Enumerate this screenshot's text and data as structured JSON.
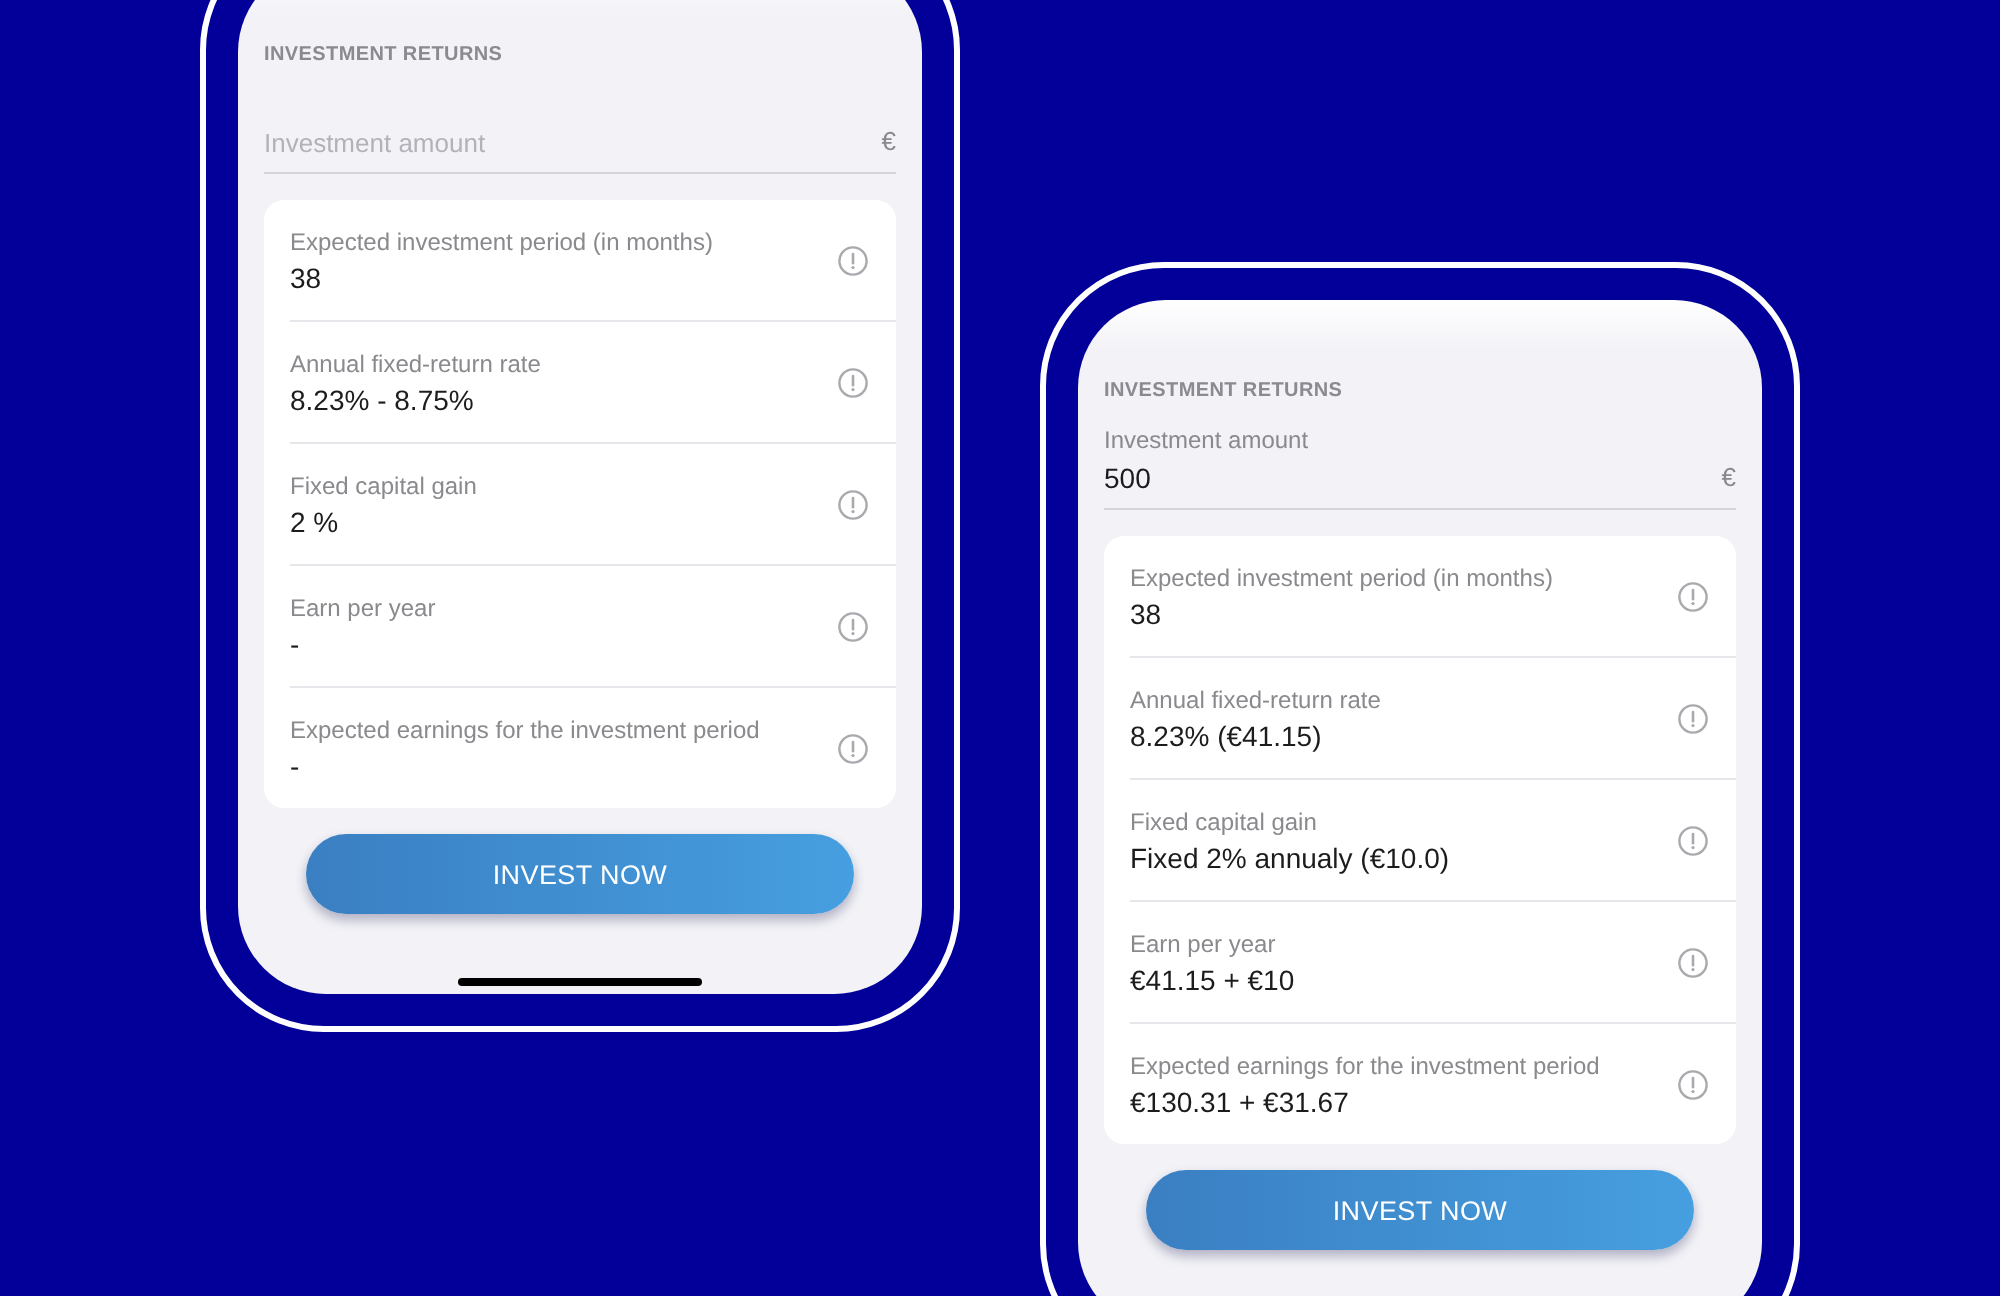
{
  "phones": [
    {
      "section_title": "INVESTMENT RETURNS",
      "amount_field": {
        "placeholder": "Investment amount",
        "currency": "€"
      },
      "details": [
        {
          "label": "Expected investment period (in months)",
          "value": "38"
        },
        {
          "label": "Annual fixed-return rate",
          "value": "8.23% - 8.75%"
        },
        {
          "label": "Fixed capital gain",
          "value": "2 %"
        },
        {
          "label": "Earn per year",
          "value": "-"
        },
        {
          "label": "Expected earnings for the investment period",
          "value": "-"
        }
      ],
      "button": "INVEST NOW"
    },
    {
      "section_title": "INVESTMENT RETURNS",
      "amount_field": {
        "label": "Investment amount",
        "value": "500",
        "currency": "€"
      },
      "details": [
        {
          "label": "Expected investment period (in months)",
          "value": "38"
        },
        {
          "label": "Annual fixed-return rate",
          "value": "8.23% (€41.15)"
        },
        {
          "label": "Fixed capital gain",
          "value": "Fixed 2% annualy (€10.0)"
        },
        {
          "label": "Earn per year",
          "value": "€41.15 + €10"
        },
        {
          "label": "Expected earnings for the investment period",
          "value": "€130.31 + €31.67"
        }
      ],
      "button": "INVEST NOW"
    }
  ]
}
